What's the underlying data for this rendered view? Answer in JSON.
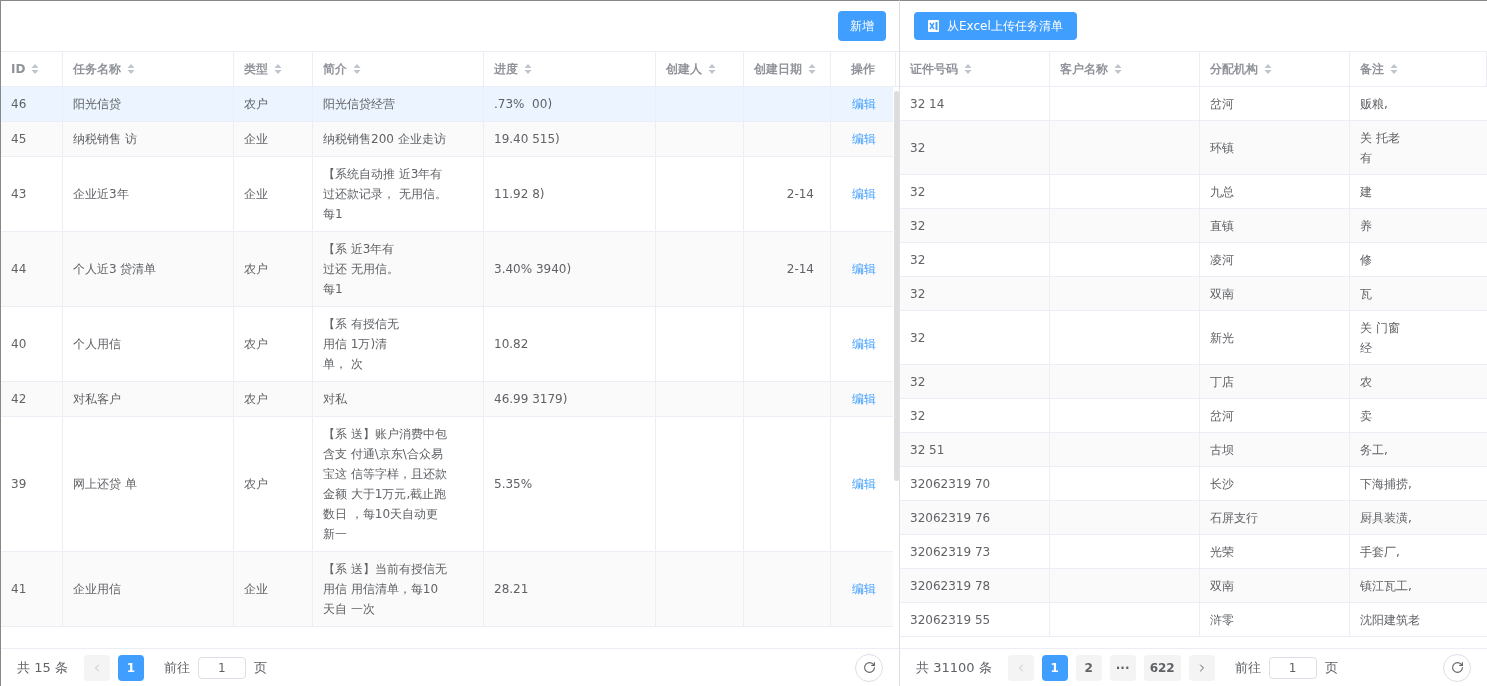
{
  "left": {
    "add_button": "新增",
    "columns": [
      {
        "label": "ID",
        "sortable": true
      },
      {
        "label": "任务名称",
        "sortable": true
      },
      {
        "label": "类型",
        "sortable": true
      },
      {
        "label": "简介",
        "sortable": true
      },
      {
        "label": "进度",
        "sortable": true
      },
      {
        "label": "创建人",
        "sortable": true
      },
      {
        "label": "创建日期",
        "sortable": true
      },
      {
        "label": "操作",
        "sortable": false
      }
    ],
    "rows": [
      {
        "id": "46",
        "name": "阳光信贷",
        "type": "农户",
        "intro": [
          "阳光信贷经营"
        ],
        "progress": ".73%  00)",
        "date": "",
        "action": "编辑",
        "selected": true
      },
      {
        "id": "45",
        "name": "纳税销售 访",
        "type": "企业",
        "intro": [
          "纳税销售200 企业走访"
        ],
        "progress": "19.40 515)",
        "date": "",
        "action": "编辑",
        "selected": false
      },
      {
        "id": "43",
        "name": "企业近3年",
        "type": "企业",
        "intro": [
          "【系统自动推 近3年有",
          "过还款记录， 无用信。",
          "每1"
        ],
        "progress": "11.92 8)",
        "date": "2-14",
        "action": "编辑",
        "selected": false
      },
      {
        "id": "44",
        "name": "个人近3 贷清单",
        "type": "农户",
        "intro": [
          "【系 近3年有",
          "过还 无用信。",
          "每1"
        ],
        "progress": "3.40% 3940)",
        "date": "2-14",
        "action": "编辑",
        "selected": false
      },
      {
        "id": "40",
        "name": "个人用信",
        "type": "农户",
        "intro": [
          "【系 有授信无",
          "用信 1万)清",
          "单， 次"
        ],
        "progress": "10.82",
        "date": "",
        "action": "编辑",
        "selected": false
      },
      {
        "id": "42",
        "name": "对私客户",
        "type": "农户",
        "intro": [
          "对私"
        ],
        "progress": "46.99 3179)",
        "date": "",
        "action": "编辑",
        "selected": false
      },
      {
        "id": "39",
        "name": "网上还贷 单",
        "type": "农户",
        "intro": [
          "【系 送】账户消费中包",
          "含支 付通\\京东\\合众易",
          "宝这 信等字样，且还款",
          "金额 大于1万元,截止跑",
          "数日 ，每10天自动更",
          "新一"
        ],
        "progress": "5.35%",
        "date": "",
        "action": "编辑",
        "selected": false
      },
      {
        "id": "41",
        "name": "企业用信",
        "type": "企业",
        "intro": [
          "【系 送】当前有授信无",
          "用信 用信清单，每10",
          "天自 一次"
        ],
        "progress": "28.21",
        "date": "",
        "action": "编辑",
        "selected": false
      }
    ],
    "pagination": {
      "total": "共 15 条",
      "pages": [
        {
          "label": "1",
          "selected": true
        }
      ],
      "goto": "前往",
      "page_value": "1",
      "page_suffix": "页"
    }
  },
  "right": {
    "upload_button": "从Excel上传任务清单",
    "columns": [
      {
        "label": "证件号码",
        "sortable": true
      },
      {
        "label": "客户名称",
        "sortable": true
      },
      {
        "label": "分配机构",
        "sortable": true
      },
      {
        "label": "备注",
        "sortable": true
      }
    ],
    "rows": [
      {
        "id_number": "32 14",
        "branch": "岔河",
        "note": [
          "贩粮,"
        ]
      },
      {
        "id_number": "32",
        "branch": "环镇",
        "note": [
          "关 托老",
          "有"
        ]
      },
      {
        "id_number": "32",
        "branch": "九总",
        "note": [
          "建"
        ]
      },
      {
        "id_number": "32",
        "branch": "直镇",
        "note": [
          "养"
        ]
      },
      {
        "id_number": "32",
        "branch": "凌河",
        "note": [
          "修"
        ]
      },
      {
        "id_number": "32",
        "branch": "双南",
        "note": [
          "瓦"
        ]
      },
      {
        "id_number": "32",
        "branch": "新光",
        "note": [
          "关 门窗",
          "经"
        ]
      },
      {
        "id_number": "32",
        "branch": "丁店",
        "note": [
          "农"
        ]
      },
      {
        "id_number": "32",
        "branch": "岔河",
        "note": [
          "卖"
        ]
      },
      {
        "id_number": "32 51",
        "branch": "古坝",
        "note": [
          "务工,"
        ]
      },
      {
        "id_number": "32062319 70",
        "branch": "长沙",
        "note": [
          "下海捕捞,"
        ]
      },
      {
        "id_number": "32062319 76",
        "branch": "石屏支行",
        "note": [
          "厨具装潢,"
        ]
      },
      {
        "id_number": "32062319 73",
        "branch": "光荣",
        "note": [
          "手套厂,"
        ]
      },
      {
        "id_number": "32062319 78",
        "branch": "双南",
        "note": [
          "镇江瓦工,"
        ]
      },
      {
        "id_number": "32062319 55",
        "branch": "浒零",
        "note": [
          "沈阳建筑老"
        ]
      }
    ],
    "pagination": {
      "total": "共 31100 条",
      "pages": [
        {
          "label": "1",
          "selected": true
        },
        {
          "label": "2",
          "selected": false
        },
        {
          "label": "···",
          "selected": false
        },
        {
          "label": "622",
          "selected": false
        }
      ],
      "goto": "前往",
      "page_value": "1",
      "page_suffix": "页"
    }
  }
}
